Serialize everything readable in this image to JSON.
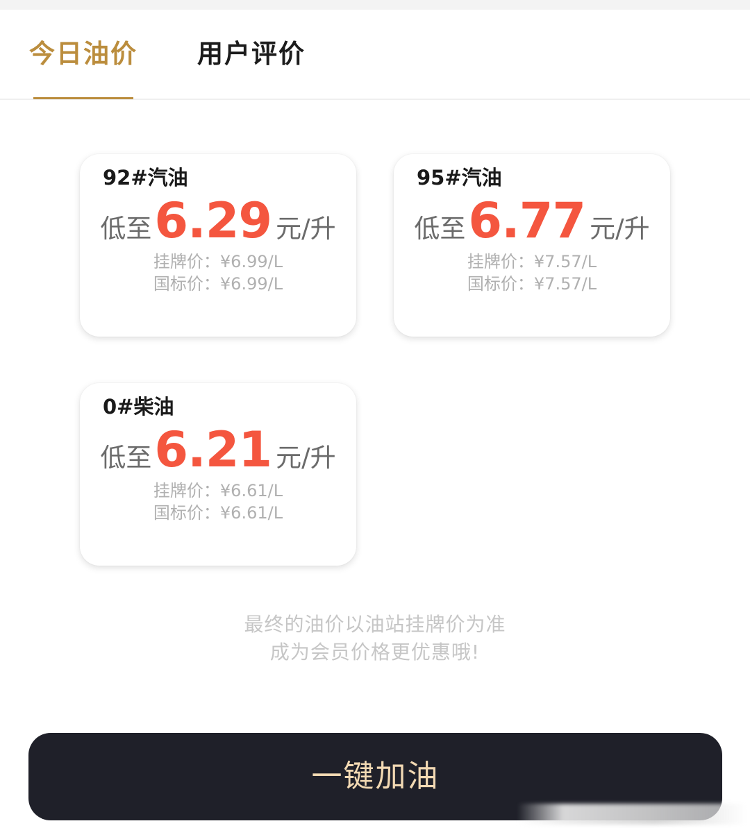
{
  "tabs": [
    {
      "label": "今日油价",
      "active": true
    },
    {
      "label": "用户评价",
      "active": false
    }
  ],
  "cards": [
    {
      "title": "92#汽油",
      "prefix": "低至",
      "price": "6.29",
      "unit": "元/升",
      "list_price": "挂牌价：¥6.99/L",
      "national_price": "国标价：¥6.99/L"
    },
    {
      "title": "95#汽油",
      "prefix": "低至",
      "price": "6.77",
      "unit": "元/升",
      "list_price": "挂牌价：¥7.57/L",
      "national_price": "国标价：¥7.57/L"
    },
    {
      "title": "0#柴油",
      "prefix": "低至",
      "price": "6.21",
      "unit": "元/升",
      "list_price": "挂牌价：¥6.61/L",
      "national_price": "国标价：¥6.61/L"
    }
  ],
  "notice": {
    "line1": "最终的油价以油站挂牌价为准",
    "line2": "成为会员价格更优惠哦!"
  },
  "action": {
    "refuel_label": "一键加油"
  },
  "colors": {
    "accent_gold": "#bb8d3d",
    "price_red": "#f4563f",
    "button_dark": "#1f2029",
    "button_text": "#f2d9b3"
  }
}
